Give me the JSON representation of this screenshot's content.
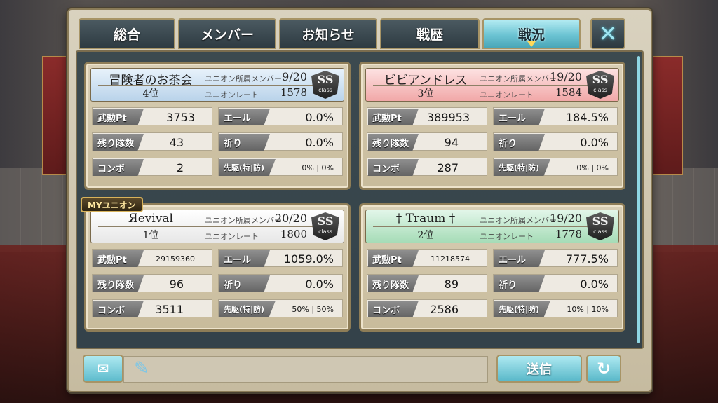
{
  "tabs": [
    {
      "label": "総合",
      "active": false
    },
    {
      "label": "メンバー",
      "active": false
    },
    {
      "label": "お知らせ",
      "active": false
    },
    {
      "label": "戦歴",
      "active": false
    },
    {
      "label": "戦況",
      "active": true
    }
  ],
  "close_icon": "✕",
  "labels": {
    "member": "ユニオン所属メンバー",
    "rate": "ユニオンレート",
    "class_word": "class",
    "stat_pt": "武勲Pt",
    "stat_remaining": "残り隊数",
    "stat_combo": "コンボ",
    "stat_yell": "エール",
    "stat_pray": "祈り",
    "stat_vanguard": "先駆(特|防)"
  },
  "my_union_tag": "MYユニオン",
  "unions": [
    {
      "name": "冒険者のお茶会",
      "rank": "4位",
      "members": "9/20",
      "rate": "1578",
      "class": "SS",
      "header_color": "blue",
      "pt": "3753",
      "remaining": "43",
      "combo": "2",
      "yell": "0.0%",
      "pray": "0.0%",
      "vanguard": "0% | 0%"
    },
    {
      "name": "ビビアンドレス",
      "rank": "3位",
      "members": "19/20",
      "rate": "1584",
      "class": "SS",
      "header_color": "red",
      "pt": "389953",
      "remaining": "94",
      "combo": "287",
      "yell": "184.5%",
      "pray": "0.0%",
      "vanguard": "0% | 0%"
    },
    {
      "name": "Яevival",
      "rank": "1位",
      "members": "20/20",
      "rate": "1800",
      "class": "SS",
      "header_color": "white",
      "pt": "29159360",
      "remaining": "96",
      "combo": "3511",
      "yell": "1059.0%",
      "pray": "0.0%",
      "vanguard": "50% | 50%"
    },
    {
      "name": "† Traum †",
      "rank": "2位",
      "members": "19/20",
      "rate": "1778",
      "class": "SS",
      "header_color": "green",
      "pt": "11218574",
      "remaining": "89",
      "combo": "2586",
      "yell": "777.5%",
      "pray": "0.0%",
      "vanguard": "10% | 10%"
    }
  ],
  "bottom": {
    "stamp_icon": "stamp-icon",
    "pen_icon": "pen-icon",
    "chat_placeholder": "",
    "send_label": "送信",
    "refresh_icon": "↻"
  }
}
